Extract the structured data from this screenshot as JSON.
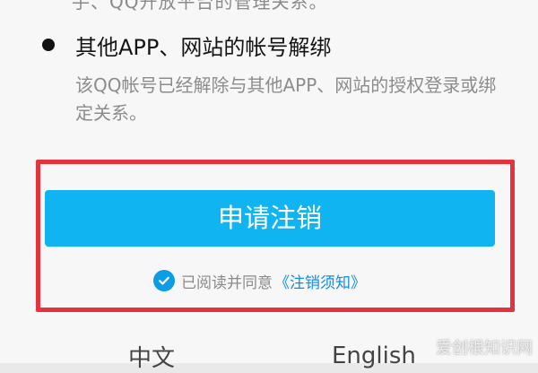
{
  "partial_text": "手、QQ开放平台的管理关系。",
  "section": {
    "title": "其他APP、网站的帐号解绑",
    "description": "该QQ帐号已经解除与其他APP、网站的授权登录或绑定关系。"
  },
  "actions": {
    "cancel_account_label": "申请注销",
    "agreement_prefix": "已阅读并同意",
    "agreement_link": "《注销须知》"
  },
  "languages": {
    "left": "中文",
    "right": "English"
  },
  "watermark": "爱创根知识网",
  "colors": {
    "button_bg": "#0fb4f0",
    "highlight_border": "#e5323f",
    "link": "#0f8ee8"
  }
}
